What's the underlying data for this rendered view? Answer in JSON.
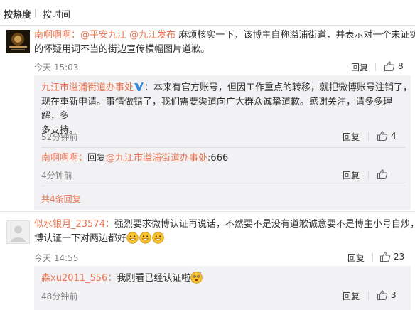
{
  "tabs": {
    "hot": "按热度",
    "time": "按时间"
  },
  "comments": [
    {
      "user": "南啊啊啊：",
      "mentions": [
        "@平安九江",
        "@九江发布"
      ],
      "text": "麻烦核实一下，该博主自称溢浦街道，并表示对一个未证实的怀疑用词不当的街边宣传横幅图片道歉。",
      "line1_tail": "麻烦核实一下，该博主自称溢浦街道，并表示对一个未证实",
      "line2": "的怀疑用词不当的街边宣传横幅图片道歉。",
      "time": "今天 15:03",
      "reply_label": "回复",
      "likes": "8",
      "replies": [
        {
          "user": "九江市溢浦街道办事处",
          "line1": "：本来有官方账号，但因工作重点的转移，就把微博账号注销了，",
          "line2": "现在重新申请。事情做错了，我们需要渠道向广大群众诚挚道歉。感谢关注，请多多理解，多",
          "line3": "多支持。",
          "time": "52分钟前",
          "reply_label": "回复",
          "likes": "4"
        },
        {
          "user": "南啊啊啊：",
          "prefix": "回复",
          "mention": "@九江市溢浦街道办事处",
          "text": ":666",
          "time": "4分钟前",
          "reply_label": "回复"
        }
      ],
      "more": "共4条回复"
    },
    {
      "user": "似水银月_23574：",
      "line1": "强烈要求微博认证再说话，不然要不是没有道歉诚意要不是博主小号自炒，微",
      "line2": "博认证一下对两边都好",
      "time": "今天 14:55",
      "reply_label": "回复",
      "likes": "23",
      "replies": [
        {
          "user": "森xu2011_556：",
          "text": "我刚看已经认证啦",
          "time": "48分钟前",
          "reply_label": "回复",
          "likes": "3"
        }
      ]
    }
  ],
  "colors": {
    "username": "#eb7350",
    "reply_bg": "#f2f2f5",
    "verified": "#3a8de0",
    "emoji": "#f8c32c"
  },
  "icons": {
    "like": "thumbs-up-icon",
    "verified": "verified-v-icon",
    "emoji": "grin-emoji-icon"
  }
}
